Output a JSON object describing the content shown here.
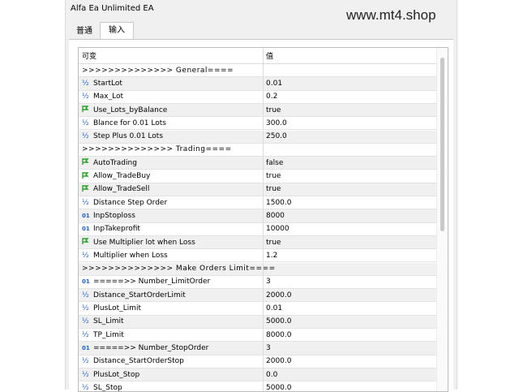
{
  "window": {
    "title": "Alfa Ea Unlimited EA"
  },
  "watermark": "www.mt4.shop",
  "tabs": [
    {
      "label": "普通"
    },
    {
      "label": "输入"
    }
  ],
  "grid": {
    "headers": {
      "name": "可变",
      "value": "值"
    },
    "rows": [
      {
        "type": "separator",
        "name": ">>>>>>>>>>>>>> General====",
        "value": ""
      },
      {
        "type": "double",
        "name": "StartLot",
        "value": "0.01"
      },
      {
        "type": "double",
        "name": "Max_Lot",
        "value": "0.2"
      },
      {
        "type": "bool",
        "name": "Use_Lots_byBalance",
        "value": "true"
      },
      {
        "type": "double",
        "name": "Blance for 0.01 Lots",
        "value": "300.0"
      },
      {
        "type": "double",
        "name": "Step Plus 0.01 Lots",
        "value": "250.0"
      },
      {
        "type": "separator",
        "name": ">>>>>>>>>>>>>> Trading====",
        "value": ""
      },
      {
        "type": "bool",
        "name": "AutoTrading",
        "value": "false"
      },
      {
        "type": "bool",
        "name": "Allow_TradeBuy",
        "value": "true"
      },
      {
        "type": "bool",
        "name": "Allow_TradeSell",
        "value": "true"
      },
      {
        "type": "double",
        "name": "Distance Step Order",
        "value": "1500.0"
      },
      {
        "type": "int",
        "name": "InpStoploss",
        "value": "8000"
      },
      {
        "type": "int",
        "name": "InpTakeprofit",
        "value": "10000"
      },
      {
        "type": "bool",
        "name": "Use Multiplier lot when Loss",
        "value": "true"
      },
      {
        "type": "double",
        "name": "Multiplier when Loss",
        "value": "1.2"
      },
      {
        "type": "separator",
        "name": ">>>>>>>>>>>>>> Make Orders Limit====",
        "value": ""
      },
      {
        "type": "int",
        "name": "=====>> Number_LimitOrder",
        "value": "3"
      },
      {
        "type": "double",
        "name": "Distance_StartOrderLimit",
        "value": "2000.0"
      },
      {
        "type": "double",
        "name": "PlusLot_Limit",
        "value": "0.01"
      },
      {
        "type": "double",
        "name": "SL_Limit",
        "value": "5000.0"
      },
      {
        "type": "double",
        "name": "TP_Limit",
        "value": "8000.0"
      },
      {
        "type": "int",
        "name": "=====>> Number_StopOrder",
        "value": "3"
      },
      {
        "type": "double",
        "name": "Distance_StartOrderStop",
        "value": "2000.0"
      },
      {
        "type": "double",
        "name": "PlusLot_Stop",
        "value": "0.0"
      },
      {
        "type": "double",
        "name": "SL_Stop",
        "value": "5000.0"
      }
    ]
  },
  "icons": {
    "double": "½",
    "int": "01",
    "bool": "flag-arrow-icon"
  },
  "colors": {
    "row_alt": "#f0f0f0",
    "icon_blue": "#1e63c8",
    "icon_green": "#2aa02a"
  }
}
